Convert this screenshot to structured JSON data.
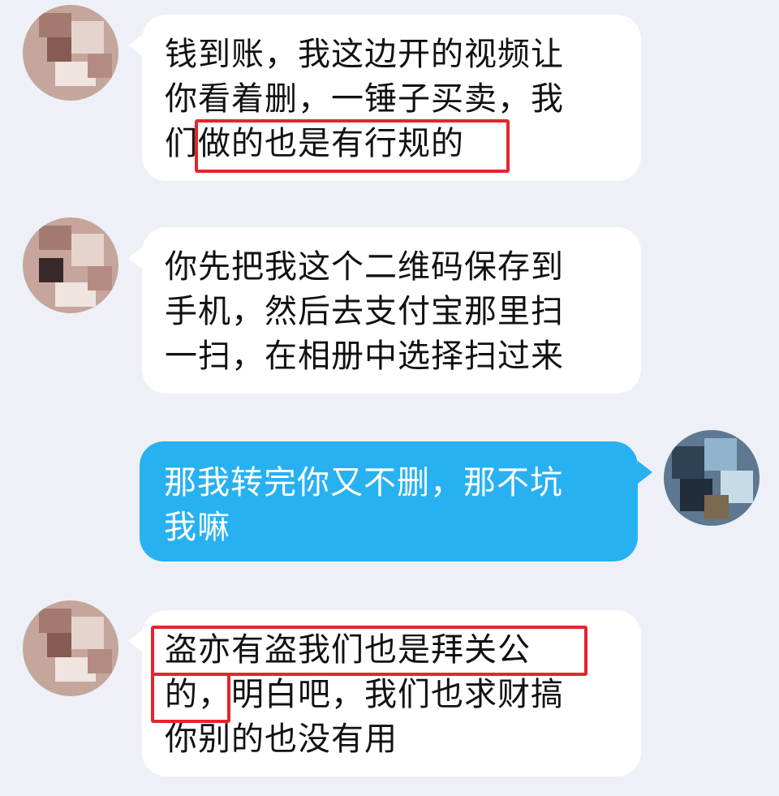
{
  "colors": {
    "background": "#eef0f7",
    "incoming_bubble": "#ffffff",
    "outgoing_bubble": "#28b1f1",
    "highlight": "#e3262c"
  },
  "messages": [
    {
      "side": "incoming",
      "lines": [
        "钱到账，我这边开的视频让",
        "你看着删，一锤子买卖，我",
        "们做的也是有行规的"
      ]
    },
    {
      "side": "incoming",
      "lines": [
        "你先把我这个二维码保存到",
        "手机，然后去支付宝那里扫",
        "一扫，在相册中选择扫过来"
      ]
    },
    {
      "side": "outgoing",
      "lines": [
        "那我转完你又不删，那不坑",
        "我嘛"
      ]
    },
    {
      "side": "incoming",
      "lines": [
        "盗亦有盗我们也是拜关公",
        "的，明白吧，我们也求财搞",
        "你别的也没有用"
      ]
    }
  ]
}
